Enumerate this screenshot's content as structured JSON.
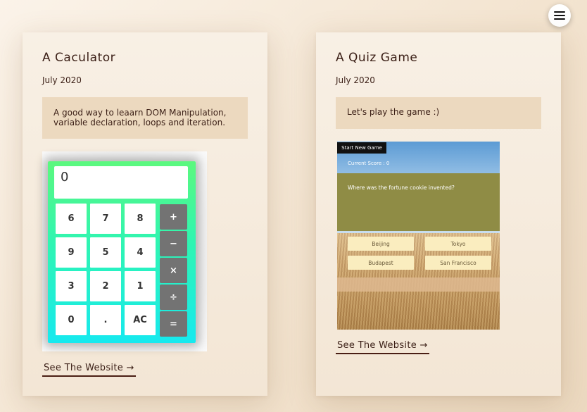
{
  "menu": {
    "icon": "hamburger-menu-icon"
  },
  "projects": [
    {
      "title": "A Caculator",
      "date": "July 2020",
      "description": "A good way to leaarn DOM Manipulation, variable declaration, loops and iteration.",
      "link_label": "See The Website →",
      "preview": {
        "display": "0",
        "keys": [
          "6",
          "7",
          "8",
          "9",
          "5",
          "4",
          "3",
          "2",
          "1",
          "0",
          ".",
          "AC"
        ],
        "operators": [
          "+",
          "−",
          "×",
          "÷",
          "="
        ],
        "colors": {
          "gradient_top": "#5cf87e",
          "gradient_bottom": "#16e9ef",
          "operator": "#737373"
        }
      }
    },
    {
      "title": "A Quiz Game",
      "date": "July 2020",
      "description": "Let's play the game :)",
      "link_label": "See The Website →",
      "preview": {
        "start_button": "Start New Game",
        "score": "Current Score : 0",
        "question": "Where was the fortune cookie invented?",
        "answers": [
          "Beijing",
          "Tokyo",
          "Budapest",
          "San Francisco"
        ],
        "colors": {
          "panel": "#8f8c45",
          "answer_bg": "#faedbf"
        }
      }
    }
  ],
  "colors": {
    "card_bg": "#f6ede1",
    "desc_bg": "#ecd9bf",
    "text": "#3b1f16",
    "link_underline": "#4a1e14"
  }
}
